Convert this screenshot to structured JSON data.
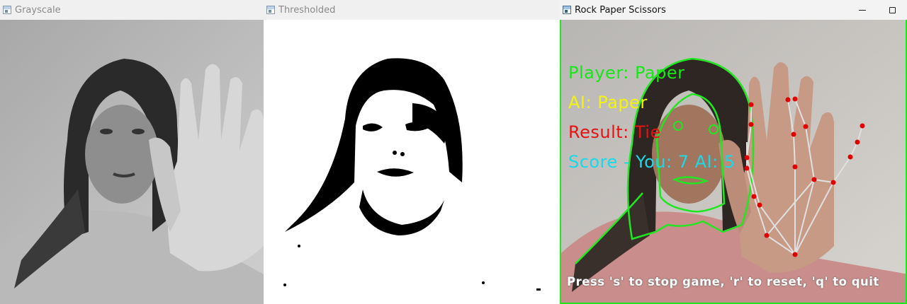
{
  "windows": [
    {
      "title": "Grayscale",
      "state": "inactive"
    },
    {
      "title": "Thresholded",
      "state": "inactive"
    },
    {
      "title": "Rock Paper Scissors",
      "state": "active"
    }
  ],
  "controls": {
    "minimize": "minimize",
    "maximize": "maximize"
  },
  "game": {
    "player_label": "Player: Paper",
    "ai_label": "AI: Paper",
    "result_label": "Result: Tie",
    "score_label": "Score - You: 7  AI: 5",
    "hint": "Press 's' to stop game, 'r' to reset, 'q' to quit"
  },
  "colors": {
    "player": "#17e617",
    "ai": "#f4f40b",
    "result": "#e51212",
    "score": "#19d9e8",
    "contour": "#22e622",
    "landmark": "#e00000",
    "skeleton": "#e0e0e0"
  },
  "icons": [
    "app-window-icon",
    "minimize-icon",
    "maximize-icon"
  ]
}
